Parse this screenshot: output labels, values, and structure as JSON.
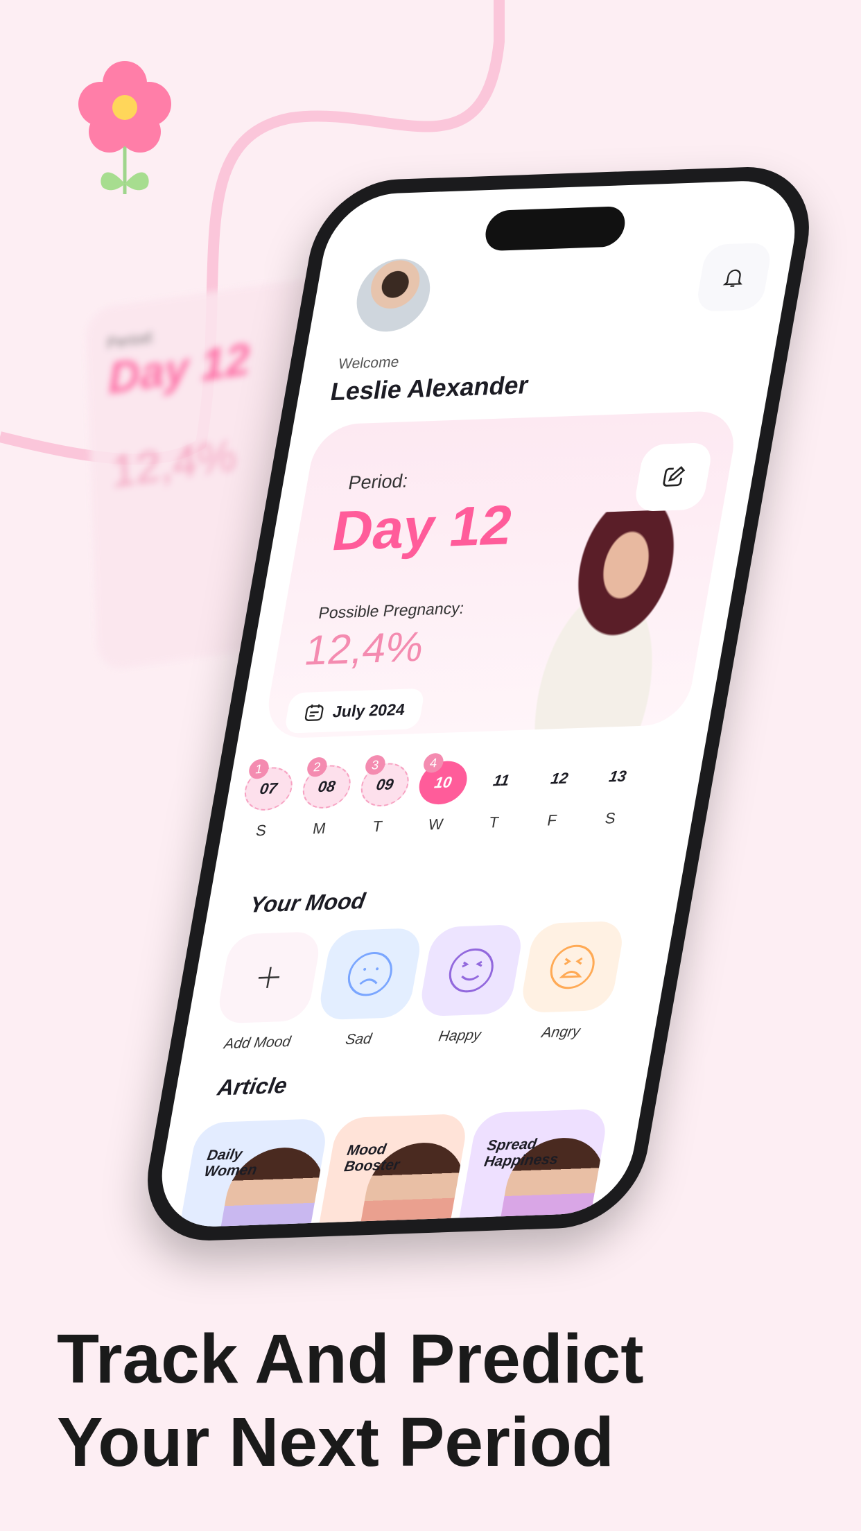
{
  "header": {
    "welcome": "Welcome",
    "user_name": "Leslie Alexander"
  },
  "period_card": {
    "period_label": "Period:",
    "day": "Day 12",
    "pregnancy_label": "Possible Pregnancy:",
    "pregnancy_value": "12,4%",
    "month": "July 2024"
  },
  "calendar": [
    {
      "badge": "1",
      "date": "07",
      "weekday": "S",
      "state": "period"
    },
    {
      "badge": "2",
      "date": "08",
      "weekday": "M",
      "state": "period"
    },
    {
      "badge": "3",
      "date": "09",
      "weekday": "T",
      "state": "period"
    },
    {
      "badge": "4",
      "date": "10",
      "weekday": "W",
      "state": "current"
    },
    {
      "badge": "",
      "date": "11",
      "weekday": "T",
      "state": "future"
    },
    {
      "badge": "",
      "date": "12",
      "weekday": "F",
      "state": "future"
    },
    {
      "badge": "",
      "date": "13",
      "weekday": "S",
      "state": "future"
    }
  ],
  "mood": {
    "title": "Your Mood",
    "items": [
      {
        "label": "Add Mood",
        "icon": "plus-icon",
        "color": "#fdf3f8"
      },
      {
        "label": "Sad",
        "icon": "sad-face-icon",
        "color": "#e3eeff"
      },
      {
        "label": "Happy",
        "icon": "happy-face-icon",
        "color": "#ede4ff"
      },
      {
        "label": "Angry",
        "icon": "angry-face-icon",
        "color": "#fff1e3"
      }
    ]
  },
  "articles": {
    "title": "Article",
    "items": [
      {
        "title": "Daily Women",
        "color": "#e3ecff"
      },
      {
        "title": "Mood Booster",
        "color": "#ffe3d8"
      },
      {
        "title": "Spread Happiness",
        "color": "#eee0ff"
      }
    ]
  },
  "headline": {
    "line1": "Track And Predict",
    "line2": "Your Next Period"
  },
  "colors": {
    "accent": "#ff5c9a",
    "background": "#fdeef3"
  }
}
